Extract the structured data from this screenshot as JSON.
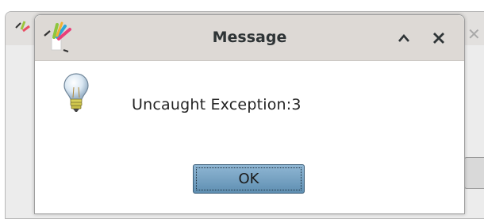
{
  "dialog": {
    "title": "Message",
    "message": "Uncaught Exception:3",
    "ok_label": "OK"
  },
  "icons": {
    "app_logo": "colorful-fork-logo-icon",
    "message_type": "lightbulb-icon",
    "maximize": "chevron-up-icon",
    "close": "close-icon"
  },
  "colors": {
    "titlebar": "#ddd9d5",
    "button_top": "#8fb6d3",
    "button_bottom": "#5f8fb2"
  }
}
